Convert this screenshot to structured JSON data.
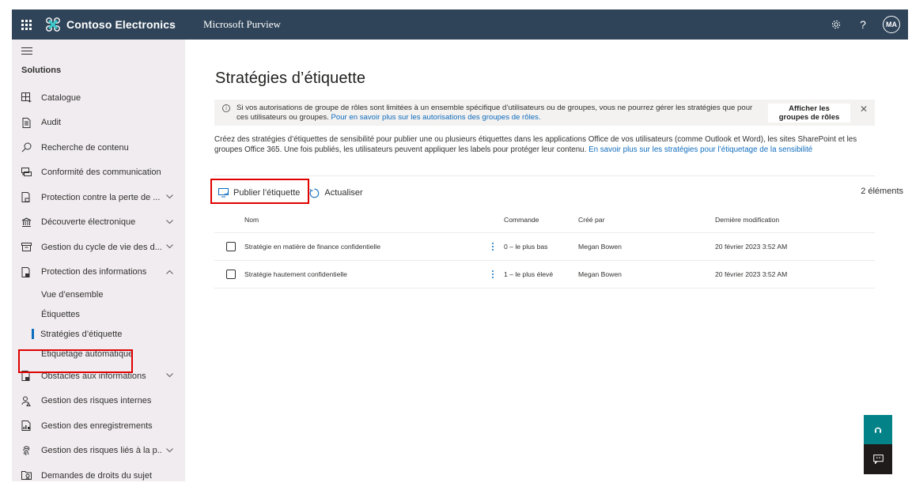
{
  "topbar": {
    "org_name": "Contoso Electronics",
    "app_name": "Microsoft Purview",
    "avatar_initials": "MA",
    "icons": [
      "app-launcher-icon",
      "settings-gear-icon",
      "help-question-icon"
    ]
  },
  "sidebar": {
    "section_title": "Solutions",
    "items": [
      {
        "label": "Catalogue",
        "icon": "catalog-grid-icon",
        "chevron": ""
      },
      {
        "label": "Audit",
        "icon": "audit-document-icon",
        "chevron": ""
      },
      {
        "label": "Recherche de contenu",
        "icon": "search-icon",
        "chevron": ""
      },
      {
        "label": "Conformité des communications",
        "icon": "chat-compliance-icon",
        "chevron": ""
      },
      {
        "label": "Protection contre la perte de ...",
        "icon": "dlp-lock-icon",
        "chevron": "down"
      },
      {
        "label": "Découverte électronique",
        "icon": "ediscovery-building-icon",
        "chevron": "down"
      },
      {
        "label": "Gestion du cycle de vie des d...",
        "icon": "archive-box-icon",
        "chevron": "down"
      },
      {
        "label": "Protection des informations",
        "icon": "info-protection-lock-icon",
        "chevron": "up"
      }
    ],
    "sub_items": [
      {
        "label": "Vue d’ensemble",
        "active": false
      },
      {
        "label": "Étiquettes",
        "active": false
      },
      {
        "label": "Stratégies d’étiquette",
        "active": true
      },
      {
        "label": "Etiquetage automatique",
        "active": false
      }
    ],
    "items_after": [
      {
        "label": "Obstacles aux informations",
        "icon": "barrier-lock-icon",
        "chevron": "down"
      },
      {
        "label": "Gestion des risques internes",
        "icon": "insider-risk-person-icon",
        "chevron": ""
      },
      {
        "label": "Gestion des enregistrements",
        "icon": "records-chart-icon",
        "chevron": ""
      },
      {
        "label": "Gestion des risques liés à la p...",
        "icon": "privacy-fingerprint-icon",
        "chevron": "down"
      },
      {
        "label": "Demandes de droits du sujet",
        "icon": "subject-rights-icon",
        "chevron": ""
      }
    ]
  },
  "main": {
    "title": "Stratégies d’étiquette",
    "banner": {
      "text": "Si vos autorisations de groupe de rôles sont limitées à un ensemble spécifique d’utilisateurs ou de groupes, vous ne pourrez gérer les stratégies que pour ces utilisateurs ou groupes. ",
      "link": "Pour en savoir plus sur les autorisations des groupes de rôles.",
      "button_line1": "Afficher les",
      "button_line2": "groupes de rôles"
    },
    "description": {
      "text": "Créez des stratégies d’étiquettes de sensibilité pour publier une ou plusieurs étiquettes dans les applications Office de vos utilisateurs (comme Outlook et Word), les sites SharePoint et les groupes Office 365. Une fois publiés, les utilisateurs peuvent appliquer les labels pour protéger leur contenu. ",
      "link": "En savoir plus sur les stratégies pour l’étiquetage de la sensibilité"
    },
    "toolbar": {
      "publish_label": "Publier l’étiquette",
      "refresh_label": "Actualiser",
      "item_count": "2 éléments"
    },
    "table": {
      "columns": [
        "Nom",
        "Commande",
        "Créé par",
        "Dernière modification"
      ],
      "rows": [
        {
          "name": "Stratégie en matière de finance confidentielle",
          "order": "0 – le plus bas",
          "created_by": "Megan Bowen",
          "modified": "20 février 2023 3:52 AM"
        },
        {
          "name": "Stratégie hautement confidentielle",
          "order": "1 – le plus élevé",
          "created_by": "Megan Bowen",
          "modified": "20 février 2023 3:52 AM"
        }
      ]
    }
  },
  "colors": {
    "topbar": "#2f4458",
    "sidebar_bg": "#f0ecef",
    "accent": "#0f6cbd",
    "highlight_box": "#e00000",
    "help_button": "#038387",
    "feedback_button": "#1f1b1a"
  }
}
